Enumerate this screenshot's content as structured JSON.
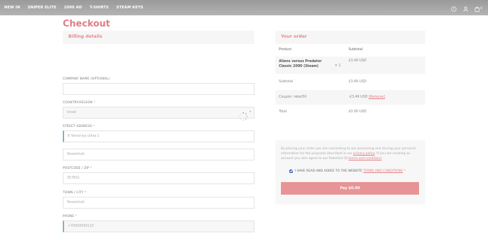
{
  "nav": {
    "items": [
      "NEW IN",
      "SNIPER ELITE",
      "2000 AD",
      "T-SHIRTS",
      "STEAM KEYS"
    ],
    "icons": [
      "help-icon",
      "user-icon",
      "cart-icon"
    ],
    "cart_count": "0"
  },
  "checkout": {
    "title": "Checkout",
    "billing_heading": "Billing details",
    "fields": {
      "company": {
        "label": "COMPANY NAME (OPTIONAL)",
        "value": ""
      },
      "country": {
        "label": "COUNTRY/REGION",
        "required": "*",
        "value": "Israel"
      },
      "street": {
        "label": "STREET ADDRESS",
        "required": "*",
        "value": "8 Yamoriya ulitsa 1",
        "value2": "Yessentuki"
      },
      "postcode": {
        "label": "POSTCODE / ZIP",
        "required": "*",
        "value": "357601"
      },
      "town": {
        "label": "TOWN / CITY",
        "required": "*",
        "value": "Yessentuki"
      },
      "phone": {
        "label": "PHONE",
        "required": "*",
        "value": "+70000000123"
      }
    }
  },
  "order": {
    "heading": "Your order",
    "col_product": "Product",
    "col_subtotal": "Subtotal",
    "product_name": "Aliens versus Predator Classic 2000 (Steam)",
    "product_qty": "× 1",
    "product_price": "£3.49 USD",
    "subtotal_label": "Subtotal",
    "subtotal_value": "£3.49 USD",
    "coupon_label": "Coupon: rebel50",
    "coupon_value": "-£3.49 USD",
    "coupon_remove": "[Remove]",
    "total_label": "Total",
    "total_value": "£0.00 USD"
  },
  "payment": {
    "privacy_part1": "By placing your order you are consenting to our processing and storing your personal information for the purposes described in our",
    "privacy_link": "privacy policy",
    "privacy_part2": ". If you are creating an account you also agree to our Rebellion ID",
    "terms_link1": "terms and conditions",
    "terms_label": "I HAVE READ AND AGREE TO THE WEBSITE",
    "terms_link2": "TERMS AND CONDITIONS",
    "terms_required": "*",
    "pay_label": "Pay $0.00"
  }
}
